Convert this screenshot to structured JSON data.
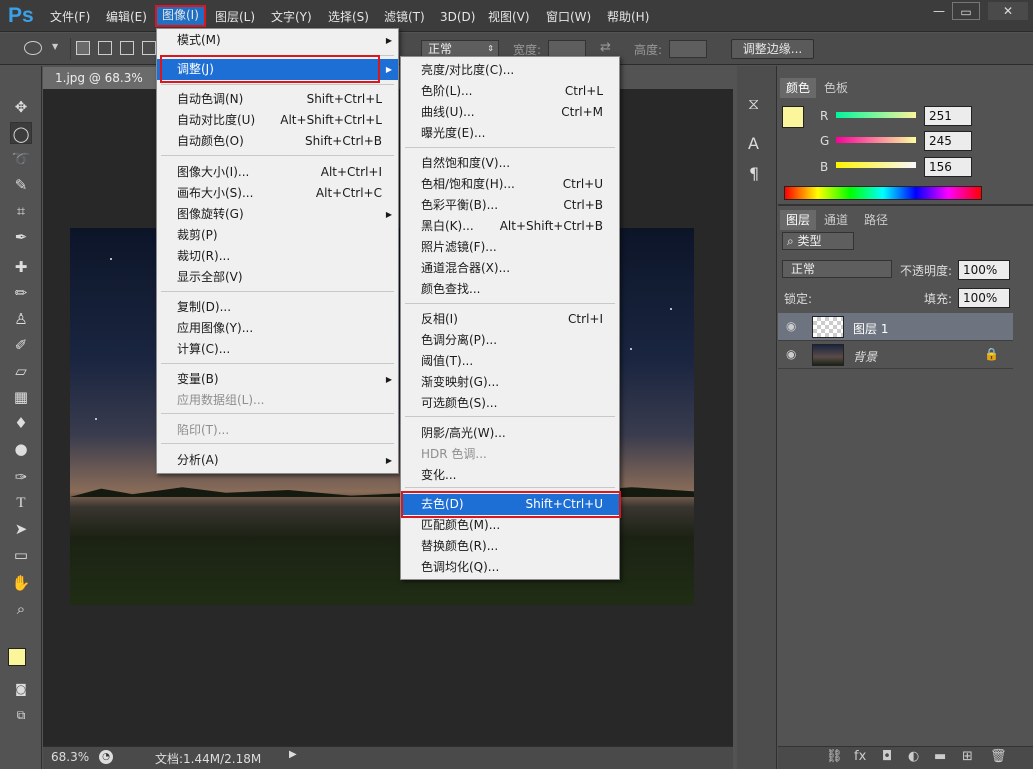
{
  "app": {
    "logo": "Ps"
  },
  "menubar": [
    "文件(F)",
    "编辑(E)",
    "图像(I)",
    "图层(L)",
    "文字(Y)",
    "选择(S)",
    "滤镜(T)",
    "3D(D)",
    "视图(V)",
    "窗口(W)",
    "帮助(H)"
  ],
  "window_controls": {
    "minimize": "—",
    "restore": "▭",
    "close": "✕"
  },
  "options": {
    "mode_label": "正常",
    "width_label": "宽度:",
    "height_label": "高度:",
    "refine_button": "调整边缘..."
  },
  "document": {
    "tab_title": "1.jpg @ 68.3% (图",
    "zoom": "68.3%",
    "doc_info": "文档:1.44M/2.18M"
  },
  "image_menu": {
    "items": [
      {
        "label": "模式(M)",
        "shortcut": "",
        "submenu": true
      },
      {
        "label": "调整(J)",
        "shortcut": "",
        "submenu": true,
        "highlighted": true
      },
      {
        "label": "自动色调(N)",
        "shortcut": "Shift+Ctrl+L"
      },
      {
        "label": "自动对比度(U)",
        "shortcut": "Alt+Shift+Ctrl+L"
      },
      {
        "label": "自动颜色(O)",
        "shortcut": "Shift+Ctrl+B"
      },
      {
        "label": "图像大小(I)...",
        "shortcut": "Alt+Ctrl+I"
      },
      {
        "label": "画布大小(S)...",
        "shortcut": "Alt+Ctrl+C"
      },
      {
        "label": "图像旋转(G)",
        "shortcut": "",
        "submenu": true
      },
      {
        "label": "裁剪(P)",
        "shortcut": ""
      },
      {
        "label": "裁切(R)...",
        "shortcut": ""
      },
      {
        "label": "显示全部(V)",
        "shortcut": ""
      },
      {
        "label": "复制(D)...",
        "shortcut": ""
      },
      {
        "label": "应用图像(Y)...",
        "shortcut": ""
      },
      {
        "label": "计算(C)...",
        "shortcut": ""
      },
      {
        "label": "变量(B)",
        "shortcut": "",
        "submenu": true
      },
      {
        "label": "应用数据组(L)...",
        "shortcut": "",
        "disabled": true
      },
      {
        "label": "陷印(T)...",
        "shortcut": "",
        "disabled": true
      },
      {
        "label": "分析(A)",
        "shortcut": "",
        "submenu": true
      }
    ]
  },
  "adjust_menu": {
    "items": [
      {
        "label": "亮度/对比度(C)...",
        "shortcut": ""
      },
      {
        "label": "色阶(L)...",
        "shortcut": "Ctrl+L"
      },
      {
        "label": "曲线(U)...",
        "shortcut": "Ctrl+M"
      },
      {
        "label": "曝光度(E)...",
        "shortcut": ""
      },
      {
        "label": "自然饱和度(V)...",
        "shortcut": ""
      },
      {
        "label": "色相/饱和度(H)...",
        "shortcut": "Ctrl+U"
      },
      {
        "label": "色彩平衡(B)...",
        "shortcut": "Ctrl+B"
      },
      {
        "label": "黑白(K)...",
        "shortcut": "Alt+Shift+Ctrl+B"
      },
      {
        "label": "照片滤镜(F)...",
        "shortcut": ""
      },
      {
        "label": "通道混合器(X)...",
        "shortcut": ""
      },
      {
        "label": "颜色查找...",
        "shortcut": ""
      },
      {
        "label": "反相(I)",
        "shortcut": "Ctrl+I"
      },
      {
        "label": "色调分离(P)...",
        "shortcut": ""
      },
      {
        "label": "阈值(T)...",
        "shortcut": ""
      },
      {
        "label": "渐变映射(G)...",
        "shortcut": ""
      },
      {
        "label": "可选颜色(S)...",
        "shortcut": ""
      },
      {
        "label": "阴影/高光(W)...",
        "shortcut": ""
      },
      {
        "label": "HDR 色调...",
        "shortcut": "",
        "disabled": true
      },
      {
        "label": "变化...",
        "shortcut": ""
      },
      {
        "label": "去色(D)",
        "shortcut": "Shift+Ctrl+U",
        "highlighted": true
      },
      {
        "label": "匹配颜色(M)...",
        "shortcut": ""
      },
      {
        "label": "替换颜色(R)...",
        "shortcut": ""
      },
      {
        "label": "色调均化(Q)...",
        "shortcut": ""
      }
    ]
  },
  "color_panel": {
    "tabs": [
      "颜色",
      "色板"
    ],
    "r": "251",
    "g": "245",
    "b": "156",
    "r_label": "R",
    "g_label": "G",
    "b_label": "B",
    "fg_color": "#fbf59c"
  },
  "layers_panel": {
    "tabs": [
      "图层",
      "通道",
      "路径"
    ],
    "filter_label": "类型",
    "blend_mode": "正常",
    "opacity_label": "不透明度:",
    "opacity": "100%",
    "lock_label": "锁定:",
    "fill_label": "填充:",
    "fill": "100%",
    "layers": [
      {
        "name": "图层 1",
        "selected": true
      },
      {
        "name": "背景",
        "locked": true
      }
    ]
  }
}
